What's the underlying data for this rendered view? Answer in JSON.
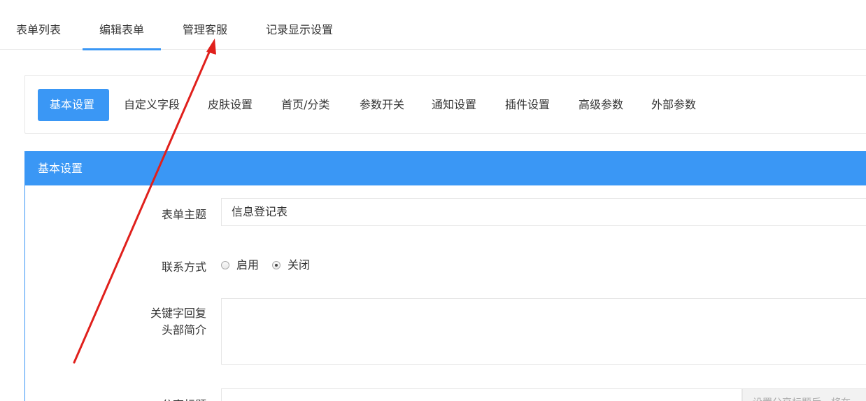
{
  "top_tabs": [
    {
      "label": "表单列表"
    },
    {
      "label": "编辑表单"
    },
    {
      "label": "管理客服"
    },
    {
      "label": "记录显示设置"
    }
  ],
  "top_tabs_active": "编辑表单",
  "sub_tabs": [
    {
      "label": "基本设置"
    },
    {
      "label": "自定义字段"
    },
    {
      "label": "皮肤设置"
    },
    {
      "label": "首页/分类"
    },
    {
      "label": "参数开关"
    },
    {
      "label": "通知设置"
    },
    {
      "label": "插件设置"
    },
    {
      "label": "高级参数"
    },
    {
      "label": "外部参数"
    }
  ],
  "sub_tabs_active": "基本设置",
  "panel": {
    "title": "基本设置"
  },
  "form": {
    "subject_label": "表单主题",
    "subject_value": "信息登记表",
    "contact_label": "联系方式",
    "contact_options": [
      {
        "label": "启用",
        "checked": false
      },
      {
        "label": "关闭",
        "checked": true
      }
    ],
    "keyword_label_line1": "关键字回复",
    "keyword_label_line2": "头部简介",
    "share_label": "分享标题",
    "share_hint": "设置分享标题后，将在"
  },
  "colors": {
    "accent": "#3a97f5",
    "annotation_arrow": "#e0201c"
  }
}
